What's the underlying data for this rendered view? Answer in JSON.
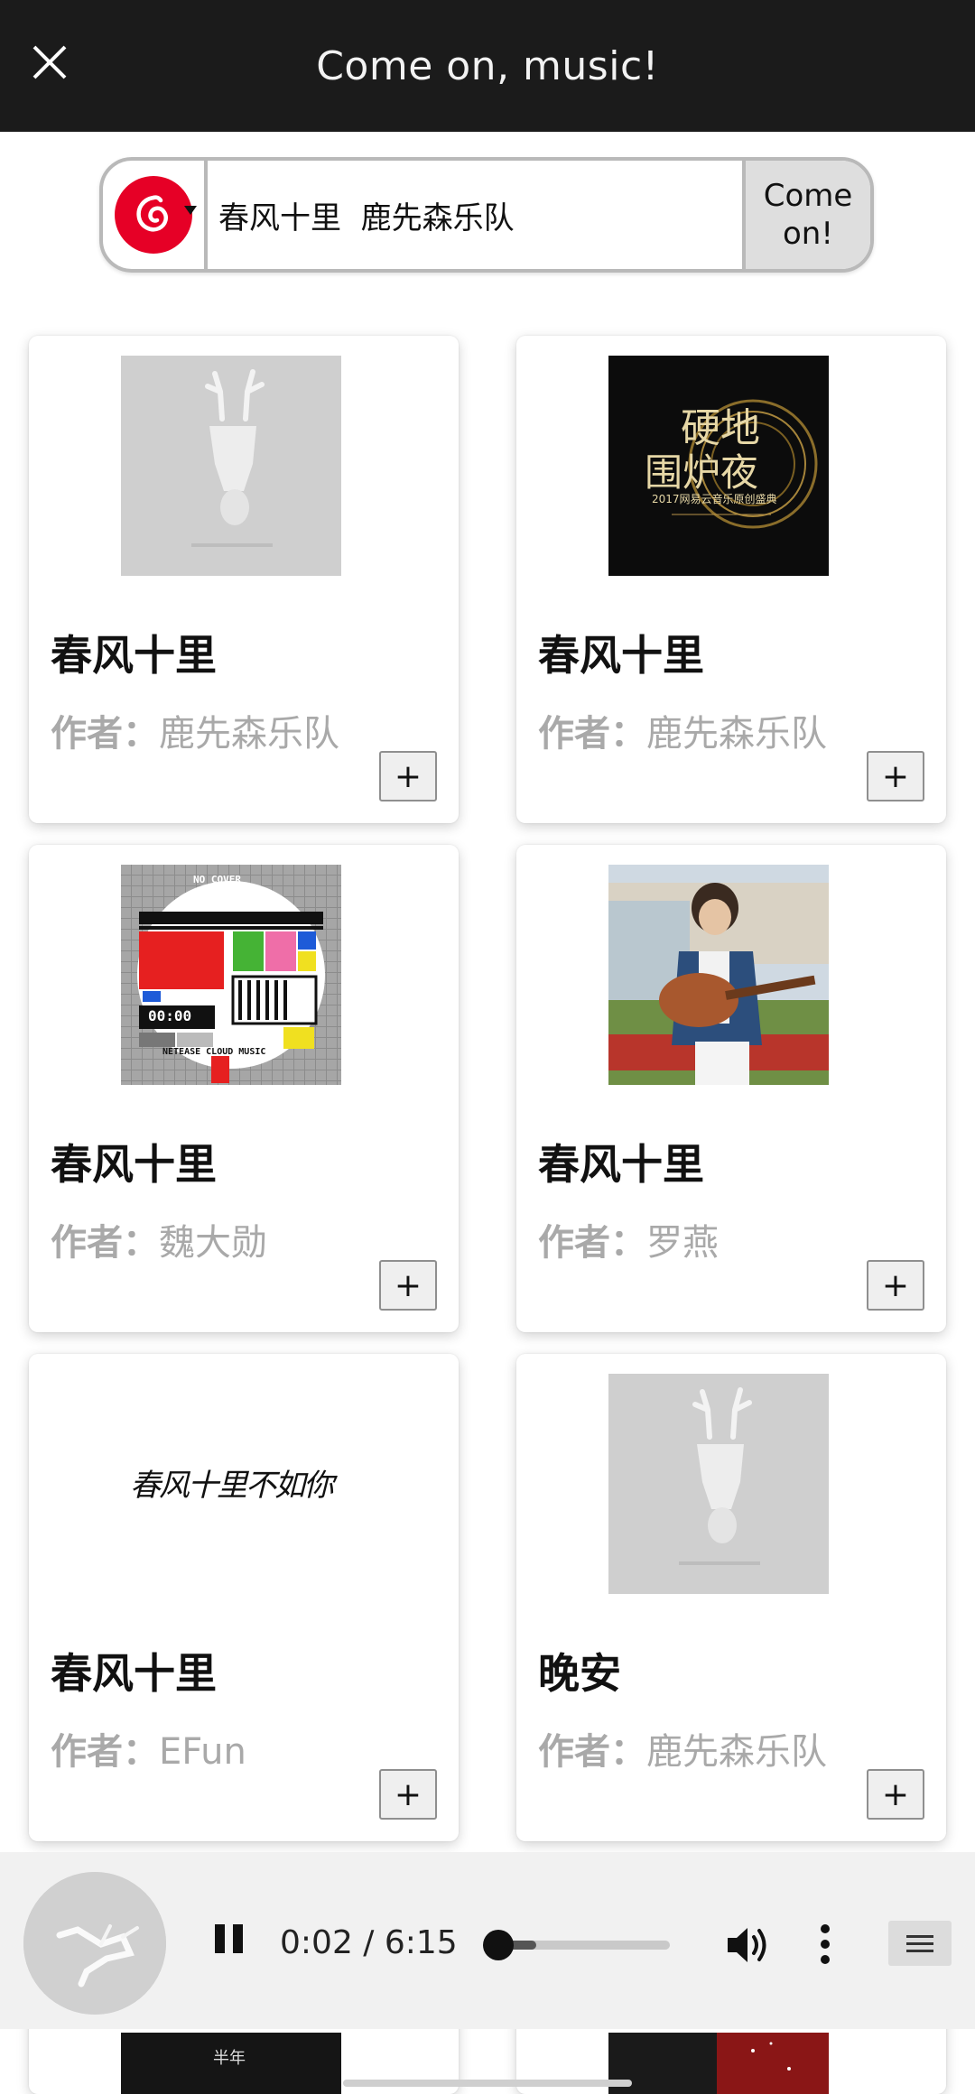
{
  "header": {
    "title": "Come on, music!"
  },
  "search": {
    "query": "春风十里  鹿先森乐队",
    "button_label": "Come on!"
  },
  "author_label": "作者：",
  "songs": [
    {
      "title": "春风十里",
      "author": "鹿先森乐队"
    },
    {
      "title": "春风十里",
      "author": "鹿先森乐队"
    },
    {
      "title": "春风十里",
      "author": "魏大勋"
    },
    {
      "title": "春风十里",
      "author": "罗燕"
    },
    {
      "title": "春风十里",
      "author": "EFun"
    },
    {
      "title": "晚安",
      "author": "鹿先森乐队"
    }
  ],
  "add_label": "+",
  "covers": {
    "c2_line1": "硬地",
    "c2_line2": "围炉夜",
    "c2_small": "2017网易云音乐原创盛典",
    "c3_top": "NO COVER",
    "c3_time": "00:00",
    "c3_bottom": "NETEASE CLOUD MUSIC",
    "c5_text": "春风十里不如你",
    "c7_text": "半年"
  },
  "player": {
    "current_time": "0:02",
    "separator": " / ",
    "duration": "6:15",
    "progress": 0.01
  },
  "colors": {
    "header_bg": "#1b1b1b",
    "netease_red": "#e60026",
    "player_bg": "#f1f1f1"
  }
}
